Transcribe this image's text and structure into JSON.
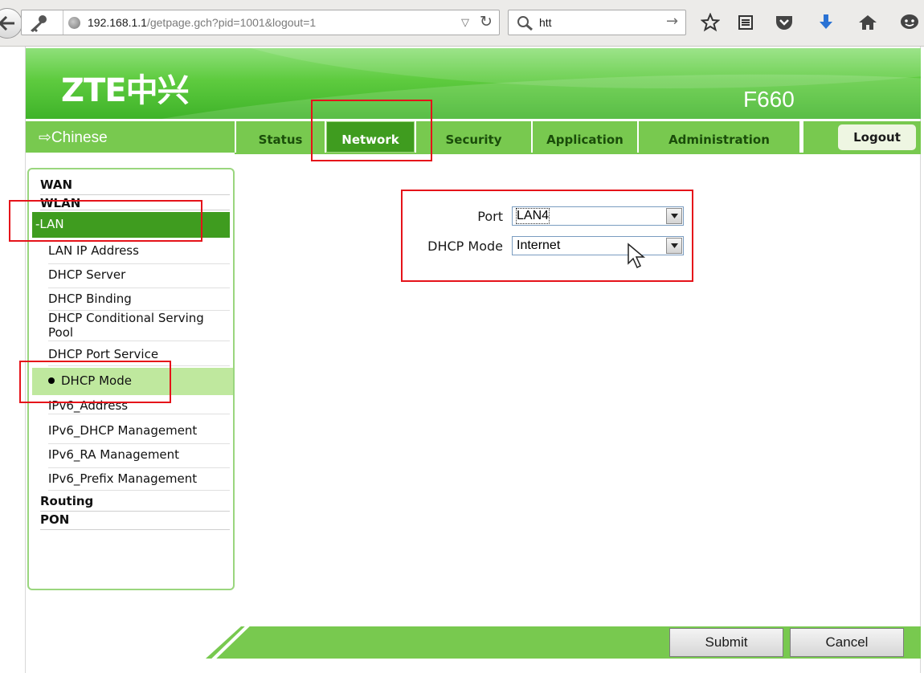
{
  "browser": {
    "url_host": "192.168.1.1",
    "url_path": "/getpage.gch?pid=1001&logout=1",
    "search_text": "htt"
  },
  "banner": {
    "logo": "ZTE中兴",
    "model": "F660"
  },
  "nav": {
    "language": "⇨Chinese",
    "tabs": [
      "Status",
      "Network",
      "Security",
      "Application",
      "Administration"
    ],
    "active_tab": "Network",
    "logout": "Logout"
  },
  "sidebar": {
    "top_items": [
      "WAN",
      "WLAN",
      "-LAN",
      "Routing",
      "PON"
    ],
    "lan_items": [
      "LAN IP Address",
      "DHCP Server",
      "DHCP Binding",
      "DHCP Conditional Serving Pool",
      "DHCP Port Service",
      "DHCP Mode",
      "IPv6_Address",
      "IPv6_DHCP Management",
      "IPv6_RA Management",
      "IPv6_Prefix Management"
    ],
    "active_item": "DHCP Mode"
  },
  "form": {
    "port_label": "Port",
    "port_value": "LAN4",
    "dhcp_mode_label": "DHCP Mode",
    "dhcp_mode_value": "Internet"
  },
  "footer": {
    "submit": "Submit",
    "cancel": "Cancel"
  },
  "colors": {
    "brand_green": "#78c94f",
    "active_green": "#3f9c1f",
    "annotation_red": "#e5131a"
  }
}
